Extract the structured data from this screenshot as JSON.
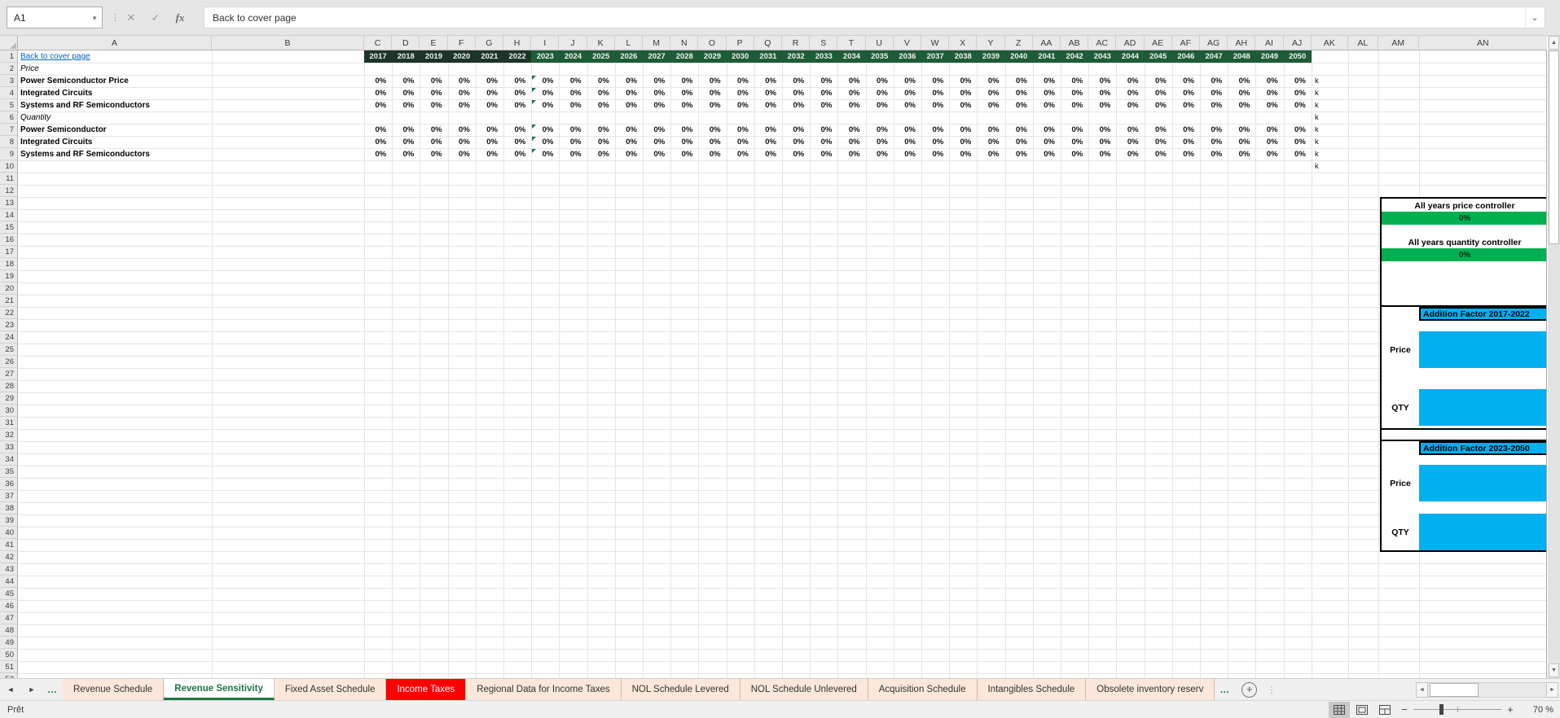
{
  "formula_bar": {
    "name_box": "A1",
    "formula": "Back to cover page"
  },
  "sheet": {
    "columns": [
      "A",
      "B",
      "C",
      "D",
      "E",
      "F",
      "G",
      "H",
      "I",
      "J",
      "K",
      "L",
      "M",
      "N",
      "O",
      "P",
      "Q",
      "R",
      "S",
      "T",
      "U",
      "V",
      "W",
      "X",
      "Y",
      "Z",
      "AA",
      "AB",
      "AC",
      "AD",
      "AE",
      "AF",
      "AG",
      "AH",
      "AI",
      "AJ",
      "AK",
      "AL",
      "AM",
      "AN"
    ],
    "rows_visible": 52,
    "a1_link": "Back to cover page",
    "years": [
      2017,
      2018,
      2019,
      2020,
      2021,
      2022,
      2023,
      2024,
      2025,
      2026,
      2027,
      2028,
      2029,
      2030,
      2031,
      2032,
      2033,
      2034,
      2035,
      2036,
      2037,
      2038,
      2039,
      2040,
      2041,
      2042,
      2043,
      2044,
      2045,
      2046,
      2047,
      2048,
      2049,
      2050
    ],
    "years_dark_count": 6,
    "rows": [
      {
        "n": 2,
        "label": "Price",
        "italic": true
      },
      {
        "n": 3,
        "label": "Power Semiconductor Price",
        "bold": true,
        "flag": true,
        "ak": "k",
        "values": [
          "0%",
          "0%",
          "0%",
          "0%",
          "0%",
          "0%",
          "0%",
          "0%",
          "0%",
          "0%",
          "0%",
          "0%",
          "0%",
          "0%",
          "0%",
          "0%",
          "0%",
          "0%",
          "0%",
          "0%",
          "0%",
          "0%",
          "0%",
          "0%",
          "0%",
          "0%",
          "0%",
          "0%",
          "0%",
          "0%",
          "0%",
          "0%",
          "0%",
          "0%"
        ]
      },
      {
        "n": 4,
        "label": "Integrated Circuits",
        "bold": true,
        "flag": true,
        "ak": "k",
        "values": [
          "0%",
          "0%",
          "0%",
          "0%",
          "0%",
          "0%",
          "0%",
          "0%",
          "0%",
          "0%",
          "0%",
          "0%",
          "0%",
          "0%",
          "0%",
          "0%",
          "0%",
          "0%",
          "0%",
          "0%",
          "0%",
          "0%",
          "0%",
          "0%",
          "0%",
          "0%",
          "0%",
          "0%",
          "0%",
          "0%",
          "0%",
          "0%",
          "0%",
          "0%"
        ]
      },
      {
        "n": 5,
        "label": "Systems and RF Semiconductors",
        "bold": true,
        "flag": true,
        "ak": "k",
        "values": [
          "0%",
          "0%",
          "0%",
          "0%",
          "0%",
          "0%",
          "0%",
          "0%",
          "0%",
          "0%",
          "0%",
          "0%",
          "0%",
          "0%",
          "0%",
          "0%",
          "0%",
          "0%",
          "0%",
          "0%",
          "0%",
          "0%",
          "0%",
          "0%",
          "0%",
          "0%",
          "0%",
          "0%",
          "0%",
          "0%",
          "0%",
          "0%",
          "0%",
          "0%"
        ]
      },
      {
        "n": 6,
        "label": "Quantity",
        "italic": true,
        "ak": "k"
      },
      {
        "n": 7,
        "label": "Power Semiconductor",
        "bold": true,
        "flag": true,
        "ak": "k",
        "values": [
          "0%",
          "0%",
          "0%",
          "0%",
          "0%",
          "0%",
          "0%",
          "0%",
          "0%",
          "0%",
          "0%",
          "0%",
          "0%",
          "0%",
          "0%",
          "0%",
          "0%",
          "0%",
          "0%",
          "0%",
          "0%",
          "0%",
          "0%",
          "0%",
          "0%",
          "0%",
          "0%",
          "0%",
          "0%",
          "0%",
          "0%",
          "0%",
          "0%",
          "0%"
        ]
      },
      {
        "n": 8,
        "label": "Integrated Circuits",
        "bold": true,
        "flag": true,
        "ak": "k",
        "values": [
          "0%",
          "0%",
          "0%",
          "0%",
          "0%",
          "0%",
          "0%",
          "0%",
          "0%",
          "0%",
          "0%",
          "0%",
          "0%",
          "0%",
          "0%",
          "0%",
          "0%",
          "0%",
          "0%",
          "0%",
          "0%",
          "0%",
          "0%",
          "0%",
          "0%",
          "0%",
          "0%",
          "0%",
          "0%",
          "0%",
          "0%",
          "0%",
          "0%",
          "0%"
        ]
      },
      {
        "n": 9,
        "label": "Systems and RF Semiconductors",
        "bold": true,
        "flag": true,
        "ak": "k",
        "values": [
          "0%",
          "0%",
          "0%",
          "0%",
          "0%",
          "0%",
          "0%",
          "0%",
          "0%",
          "0%",
          "0%",
          "0%",
          "0%",
          "0%",
          "0%",
          "0%",
          "0%",
          "0%",
          "0%",
          "0%",
          "0%",
          "0%",
          "0%",
          "0%",
          "0%",
          "0%",
          "0%",
          "0%",
          "0%",
          "0%"
        ]
      },
      {
        "n": 10,
        "label": "",
        "ak": "k"
      }
    ]
  },
  "side_panel": {
    "price_controller": {
      "title": "All years price controller",
      "value": "0%"
    },
    "quantity_controller": {
      "title": "All years quantity controller",
      "value": "0%"
    },
    "factors": [
      {
        "title": "Addition Factor 2017-2022",
        "rows": [
          {
            "label": "Price"
          },
          {
            "label": "QTY"
          }
        ]
      },
      {
        "title": "Addition Factor 2023-2050",
        "rows": [
          {
            "label": "Price"
          },
          {
            "label": "QTY"
          }
        ]
      }
    ]
  },
  "tabs": {
    "nav_left": "◄",
    "nav_right": "►",
    "overflow_left": "…",
    "overflow_right": "…",
    "add_sheet": "+",
    "items": [
      {
        "label": "Revenue Schedule",
        "state": "normal"
      },
      {
        "label": "Revenue Sensitivity",
        "state": "active"
      },
      {
        "label": "Fixed Asset Schedule",
        "state": "normal"
      },
      {
        "label": "Income Taxes",
        "state": "red"
      },
      {
        "label": "Regional Data for Income Taxes",
        "state": "normal"
      },
      {
        "label": "NOL Schedule Levered",
        "state": "normal"
      },
      {
        "label": "NOL Schedule Unlevered",
        "state": "normal"
      },
      {
        "label": "Acquisition Schedule",
        "state": "normal"
      },
      {
        "label": "Intangibles Schedule",
        "state": "normal"
      },
      {
        "label": "Obsolete inventory reserv",
        "state": "normal"
      }
    ]
  },
  "status_bar": {
    "ready": "Prêt",
    "zoom_minus": "−",
    "zoom_plus": "+",
    "zoom_value": "70 %"
  },
  "colors": {
    "header_dark_green": "#1b3526",
    "header_green": "#1e5c38",
    "controller_green": "#00b050",
    "factor_blue": "#00b0f0",
    "hyperlink_blue": "#0563c1",
    "active_tab_green": "#217346",
    "tab_fill": "#fce8da",
    "income_taxes_red": "#ff0000"
  }
}
